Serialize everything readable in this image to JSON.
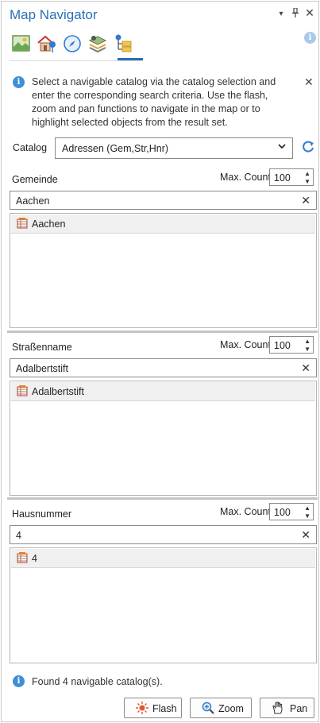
{
  "window": {
    "title": "Map Navigator",
    "controls": {
      "menu": "▾",
      "pin": "⊥",
      "close": "✕"
    }
  },
  "tool_tabs": [
    {
      "icon": "map-picture-icon",
      "active": false
    },
    {
      "icon": "house-marker-icon",
      "active": false
    },
    {
      "icon": "compass-icon",
      "active": false
    },
    {
      "icon": "layers-map-icon",
      "active": false
    },
    {
      "icon": "catalog-tree-icon",
      "active": true
    }
  ],
  "info": {
    "message": "Select a navigable catalog via the catalog selection and enter the corresponding search criteria. Use the flash, zoom and pan functions to navigate in the map or to highlight selected objects from the result set."
  },
  "catalog": {
    "label": "Catalog",
    "selected": "Adressen (Gem,Str,Hnr)"
  },
  "sections": [
    {
      "label": "Gemeinde",
      "max_count_label": "Max. Count",
      "max_count": "100",
      "search_value": "Aachen",
      "results": [
        "Aachen"
      ]
    },
    {
      "label": "Straßenname",
      "max_count_label": "Max. Count",
      "max_count": "100",
      "search_value": "Adalbertstift",
      "results": [
        "Adalbertstift"
      ]
    },
    {
      "label": "Hausnummer",
      "max_count_label": "Max. Count",
      "max_count": "100",
      "search_value": "4",
      "results": [
        "4"
      ]
    }
  ],
  "status": {
    "found_text": "Found 4 navigable catalog(s)."
  },
  "buttons": {
    "flash": "Flash",
    "zoom": "Zoom",
    "pan": "Pan"
  },
  "colors": {
    "accent": "#2b6fb8",
    "info": "#3f8fd6"
  }
}
